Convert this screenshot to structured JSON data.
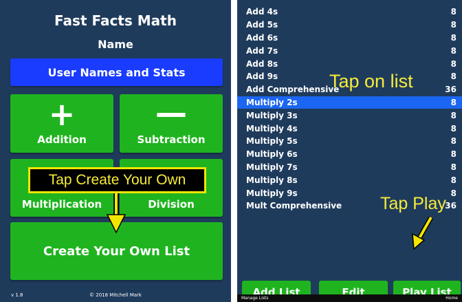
{
  "left": {
    "title": "Fast Facts Math",
    "name_label": "Name",
    "stats_button": "User Names and Stats",
    "tiles": {
      "addition": {
        "symbol": "+",
        "label": "Addition"
      },
      "subtraction": {
        "symbol": "—",
        "label": "Subtraction"
      },
      "multiplication": {
        "label": "Multiplication"
      },
      "division": {
        "label": "Division"
      },
      "create_own": {
        "label": "Create Your Own List"
      }
    },
    "callout": "Tap Create Your Own",
    "version": "v 1.8",
    "copyright": "© 2018 Mitchell Mark"
  },
  "right": {
    "list": [
      {
        "name": "Add 4s",
        "count": "8"
      },
      {
        "name": "Add 5s",
        "count": "8"
      },
      {
        "name": "Add 6s",
        "count": "8"
      },
      {
        "name": "Add 7s",
        "count": "8"
      },
      {
        "name": "Add 8s",
        "count": "8"
      },
      {
        "name": "Add 9s",
        "count": "8"
      },
      {
        "name": "Add Comprehensive",
        "count": "36"
      },
      {
        "name": "Multiply 2s",
        "count": "8",
        "selected": true
      },
      {
        "name": "Multiply 3s",
        "count": "8"
      },
      {
        "name": "Multiply 4s",
        "count": "8"
      },
      {
        "name": "Multiply 5s",
        "count": "8"
      },
      {
        "name": "Multiply 6s",
        "count": "8"
      },
      {
        "name": "Multiply 7s",
        "count": "8"
      },
      {
        "name": "Multiply 8s",
        "count": "8"
      },
      {
        "name": "Multiply 9s",
        "count": "8"
      },
      {
        "name": "Mult Comprehensive",
        "count": "36"
      }
    ],
    "tap_list_label": "Tap on list",
    "tap_play_label": "Tap Play",
    "buttons": {
      "add_list": "Add List",
      "edit": "Edit",
      "play_list": "Play List"
    },
    "bottom_bar": {
      "left": "Manage Lists",
      "right": "Home"
    }
  },
  "colors": {
    "background": "#1f3b5c",
    "tile_green": "#1fb41f",
    "stats_blue": "#1a3cff",
    "selected_row": "#1b66f2",
    "annotation_yellow": "#f7ec3a"
  }
}
